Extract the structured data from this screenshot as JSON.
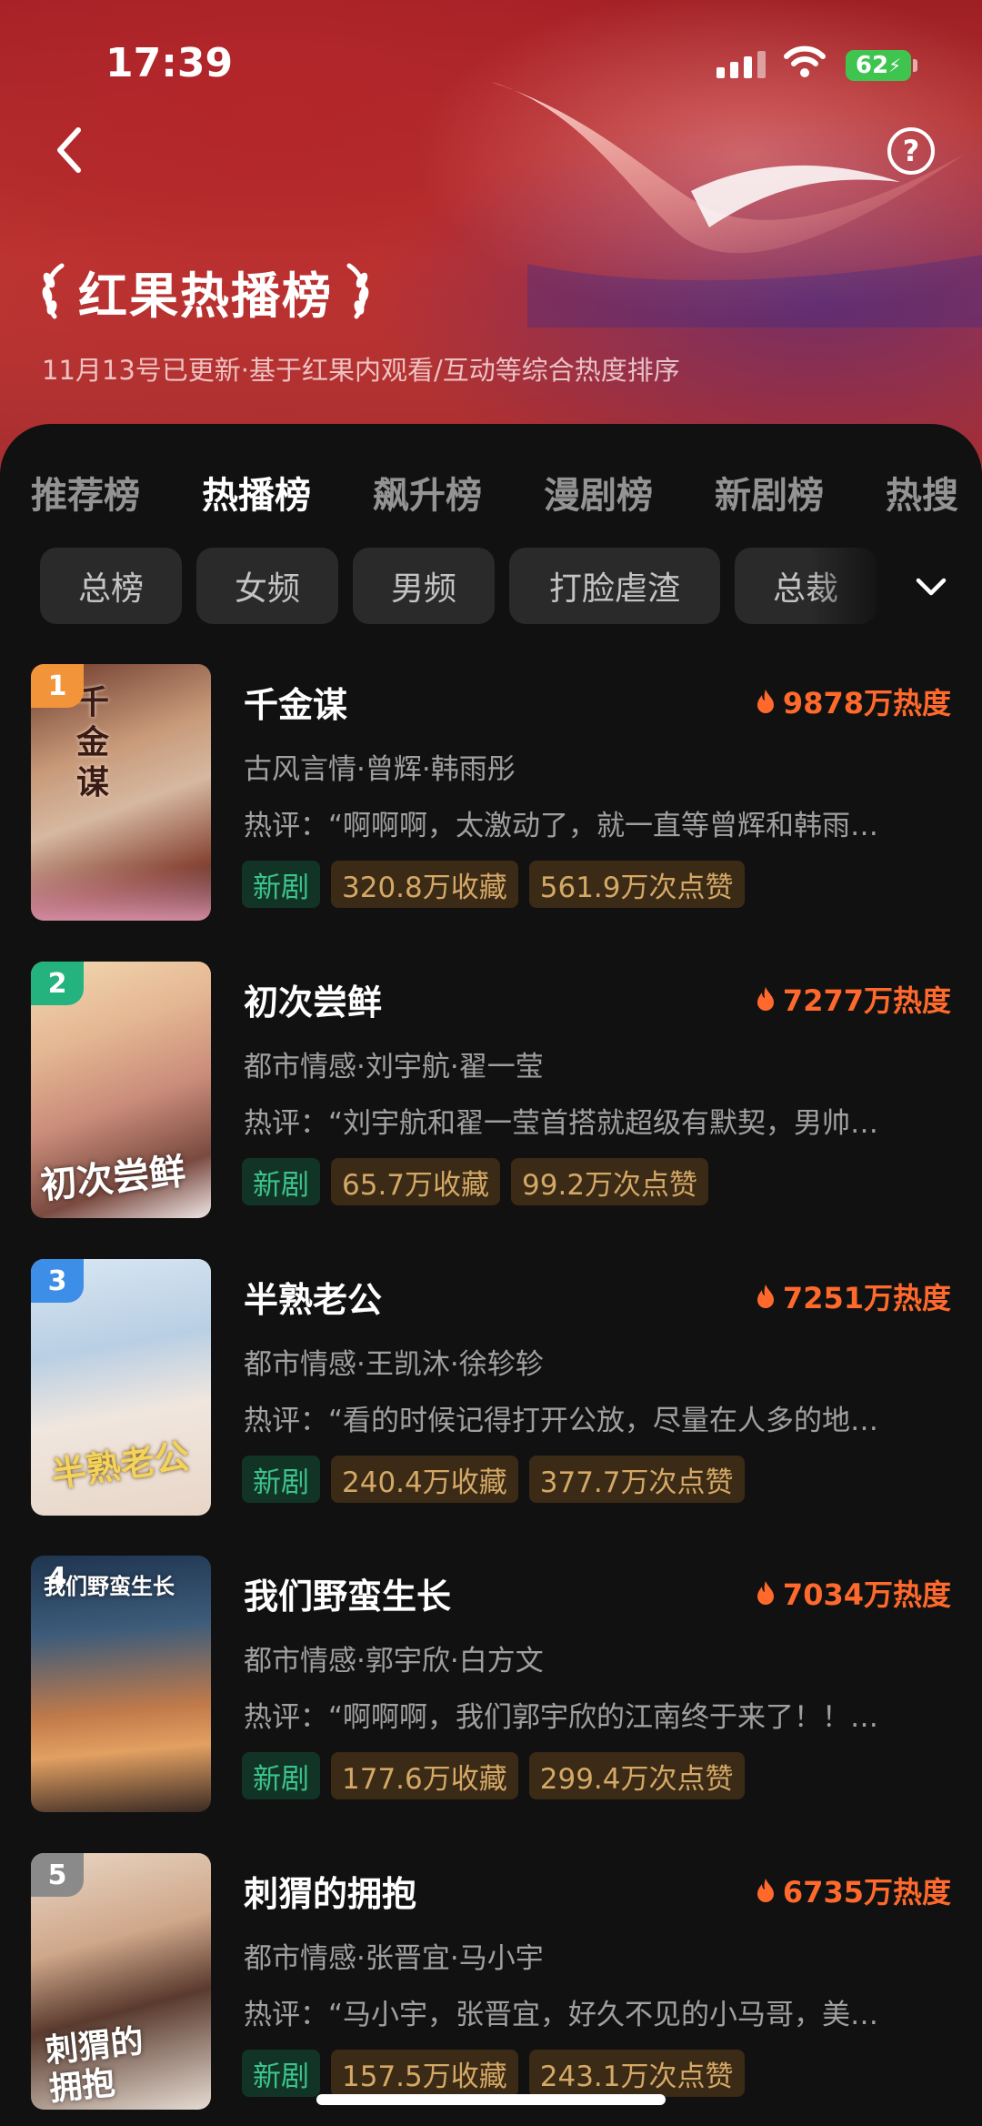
{
  "status": {
    "time": "17:39",
    "battery": "62"
  },
  "header": {
    "title": "红果热播榜",
    "subtitle": "11月13号已更新·基于红果内观看/互动等综合热度排序"
  },
  "tabs": [
    "推荐榜",
    "热播榜",
    "飙升榜",
    "漫剧榜",
    "新剧榜",
    "热搜"
  ],
  "active_tab": "热播榜",
  "chips": [
    "总榜",
    "女频",
    "男频",
    "打脸虐渣",
    "总裁"
  ],
  "colors": {
    "heat": "#ff6a2c",
    "new_tag": "#3cc38b",
    "stat_tag": "#d4a866"
  },
  "items": [
    {
      "rank": "1",
      "rank_color": "#f2953a",
      "title": "千金谋",
      "heat": "9878万热度",
      "meta": "古风言情·曾辉·韩雨彤",
      "review": "热评：“啊啊啊，太激动了，就一直等曾辉和韩雨…",
      "tags": [
        "新剧",
        "320.8万收藏",
        "561.9万次点赞"
      ],
      "poster_text": "千金谋"
    },
    {
      "rank": "2",
      "rank_color": "#24b37e",
      "title": "初次尝鲜",
      "heat": "7277万热度",
      "meta": "都市情感·刘宇航·翟一莹",
      "review": "热评：“刘宇航和翟一莹首搭就超级有默契，男帅…",
      "tags": [
        "新剧",
        "65.7万收藏",
        "99.2万次点赞"
      ],
      "poster_text": "初次尝鲜"
    },
    {
      "rank": "3",
      "rank_color": "#3d8ee6",
      "title": "半熟老公",
      "heat": "7251万热度",
      "meta": "都市情感·王凯沐·徐轸轸",
      "review": "热评：“看的时候记得打开公放，尽量在人多的地…",
      "tags": [
        "新剧",
        "240.4万收藏",
        "377.7万次点赞"
      ],
      "poster_text": "半熟老公"
    },
    {
      "rank": "4",
      "rank_color": "transparent",
      "title": "我们野蛮生长",
      "heat": "7034万热度",
      "meta": "都市情感·郭宇欣·白方文",
      "review": "热评：“啊啊啊，我们郭宇欣的江南终于来了！！…",
      "tags": [
        "新剧",
        "177.6万收藏",
        "299.4万次点赞"
      ],
      "poster_text": "我们野蛮生长"
    },
    {
      "rank": "5",
      "rank_color": "#8a8a8a",
      "title": "刺猬的拥抱",
      "heat": "6735万热度",
      "meta": "都市情感·张晋宜·马小宇",
      "review": "热评：“马小宇，张晋宜，好久不见的小马哥，美…",
      "tags": [
        "新剧",
        "157.5万收藏",
        "243.1万次点赞"
      ],
      "poster_text": "刺猬的拥抱"
    }
  ]
}
